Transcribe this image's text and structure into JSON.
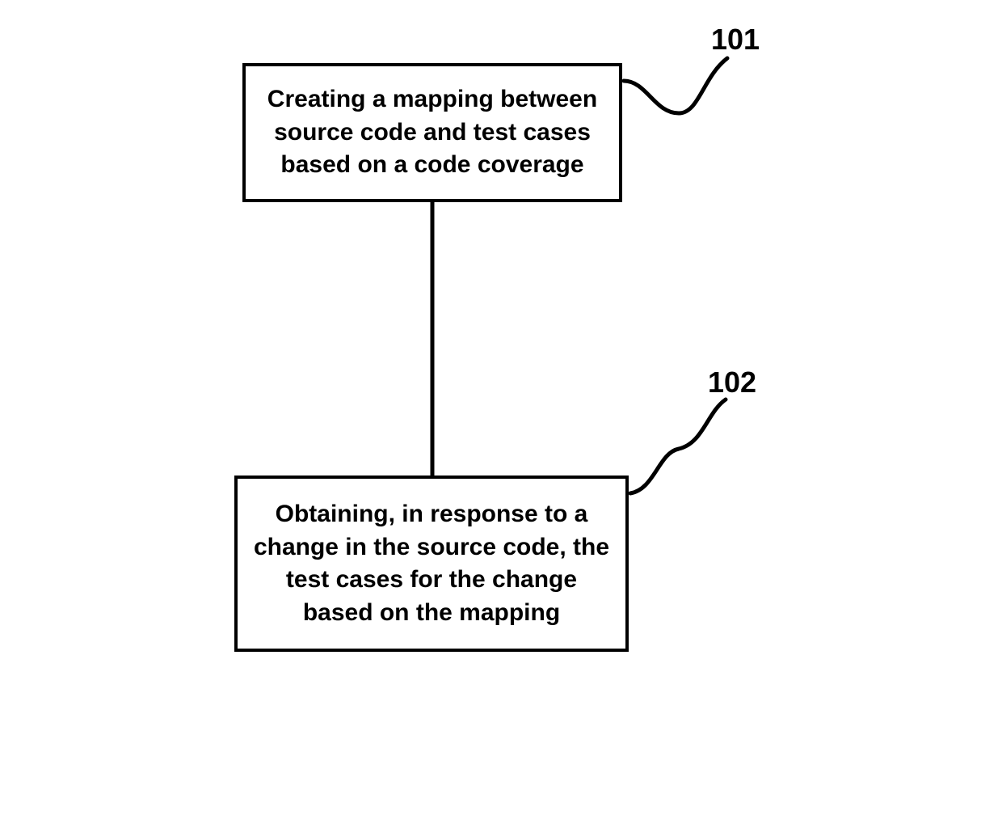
{
  "boxes": {
    "step1": {
      "label": "101",
      "text": "Creating a mapping between source code and test cases based on a code coverage"
    },
    "step2": {
      "label": "102",
      "text": "Obtaining, in response to a change in the source code, the test cases for the change based on the mapping"
    }
  }
}
